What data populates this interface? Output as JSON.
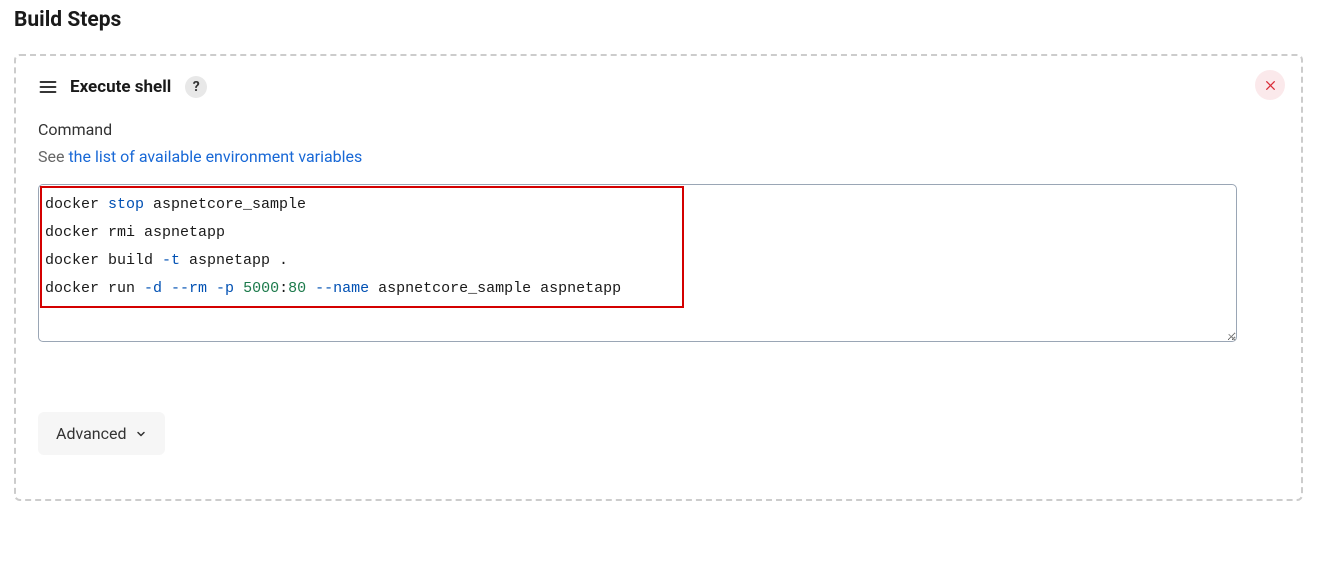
{
  "section_title": "Build Steps",
  "step": {
    "name": "Execute shell",
    "help_symbol": "?",
    "field_label": "Command",
    "help_prefix": "See ",
    "help_link_text": "the list of available environment variables",
    "lines": [
      {
        "parts": [
          {
            "t": "docker ",
            "c": "tok-cmd"
          },
          {
            "t": "stop ",
            "c": "tok-blue"
          },
          {
            "t": "aspnetcore_sample",
            "c": "tok-arg"
          }
        ]
      },
      {
        "parts": [
          {
            "t": "docker rmi aspnetapp",
            "c": "tok-cmd"
          }
        ]
      },
      {
        "parts": [
          {
            "t": "docker build ",
            "c": "tok-cmd"
          },
          {
            "t": "-t ",
            "c": "tok-flag"
          },
          {
            "t": "aspnetapp .",
            "c": "tok-arg"
          }
        ]
      },
      {
        "parts": [
          {
            "t": "docker run ",
            "c": "tok-cmd"
          },
          {
            "t": "-d --rm -p ",
            "c": "tok-flag"
          },
          {
            "t": "5000",
            "c": "tok-num"
          },
          {
            "t": ":",
            "c": "tok-cmd"
          },
          {
            "t": "80",
            "c": "tok-num"
          },
          {
            "t": " --name ",
            "c": "tok-flag"
          },
          {
            "t": "aspnetcore_sample aspnetapp",
            "c": "tok-arg"
          }
        ]
      }
    ],
    "advanced_label": "Advanced"
  }
}
